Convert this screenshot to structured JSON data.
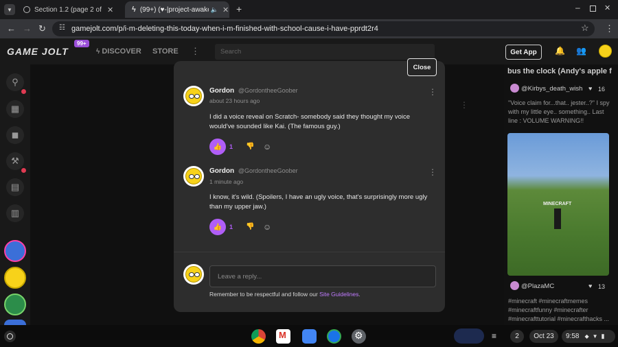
{
  "browser": {
    "tabs": [
      {
        "title": "Section 1.2 (page 2 of 5) | acc"
      },
      {
        "title": "(99+) (♥-|project-awakenin"
      }
    ],
    "new_tab_label": "+",
    "url": "gamejolt.com/p/i-m-deleting-this-today-when-i-m-finished-with-school-cause-i-have-pprdt2r4"
  },
  "site": {
    "logo": "GAME JOLT",
    "notif_badge": "99+",
    "nav": {
      "discover": "DISCOVER",
      "store": "STORE"
    },
    "search_placeholder": "Search",
    "get_app": "Get App"
  },
  "background": {
    "right_top_text": "bus the clock (Andy's apple f",
    "card1_user": "@Kirbys_death_wish",
    "card1_likes": "16",
    "card1_caption_a": "\"Voice claim for...that.. jester..?\" I spy",
    "card1_caption_b": "with my little eye.. something.. Last",
    "card1_caption_c": "line : VOLUME WARNING!!",
    "card2_user": "@PlazaMC",
    "card2_likes": "13",
    "tags_a": "#minecraft #minecraftmemes",
    "tags_b": "#minecraftfunny #minecrafter",
    "tags_c": "#minecrafttutorial #minecrafthacks ...",
    "card2_image_text": "MINECRAFT"
  },
  "modal": {
    "close_label": "Close",
    "comments": [
      {
        "name": "Gordon",
        "handle": "@GordontheeGoober",
        "time": "about 23 hours ago",
        "text": "I did a voice reveal on Scratch- somebody said they thought my voice would've sounded like Kai. (The famous guy.)",
        "likes": "1"
      },
      {
        "name": "Gordon",
        "handle": "@GordontheeGoober",
        "time": "1 minute ago",
        "text": "I know, it's wild. (Spoilers, I have an ugly voice, that's surprisingly more ugly than my upper jaw.)",
        "likes": "1"
      }
    ],
    "reply_placeholder": "Leave a reply...",
    "guidelines_prefix": "Remember to be respectful and follow our ",
    "guidelines_link": "Site Guidelines",
    "guidelines_suffix": "."
  },
  "taskbar": {
    "notif_count": "2",
    "date": "Oct 23",
    "time": "9:58"
  },
  "colors": {
    "accent": "#b05ef7",
    "badge": "#9b4fd9",
    "alert_dot": "#e03a52"
  }
}
